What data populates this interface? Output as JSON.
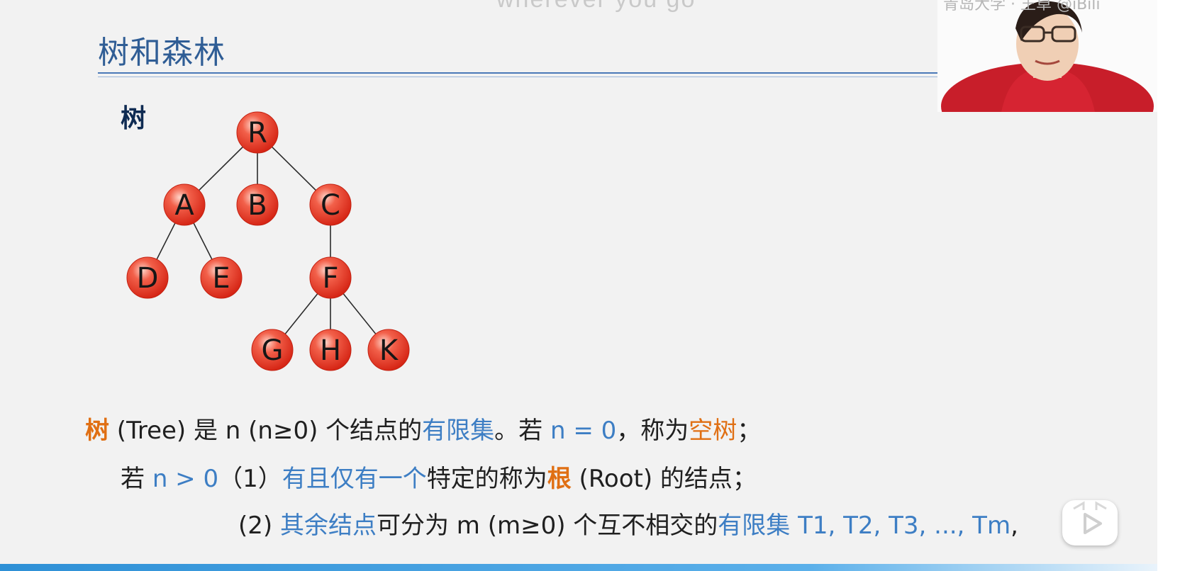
{
  "slide": {
    "top_ghost": "wherever you go",
    "title": "树和森林",
    "tree_label": "树",
    "tree_nodes": [
      {
        "id": "R",
        "label": "R"
      },
      {
        "id": "A",
        "label": "A"
      },
      {
        "id": "B",
        "label": "B"
      },
      {
        "id": "C",
        "label": "C"
      },
      {
        "id": "D",
        "label": "D"
      },
      {
        "id": "E",
        "label": "E"
      },
      {
        "id": "F",
        "label": "F"
      },
      {
        "id": "G",
        "label": "G"
      },
      {
        "id": "H",
        "label": "H"
      },
      {
        "id": "K",
        "label": "K"
      }
    ],
    "tree_edges": [
      [
        "R",
        "A"
      ],
      [
        "R",
        "B"
      ],
      [
        "R",
        "C"
      ],
      [
        "A",
        "D"
      ],
      [
        "A",
        "E"
      ],
      [
        "C",
        "F"
      ],
      [
        "F",
        "G"
      ],
      [
        "F",
        "H"
      ],
      [
        "F",
        "K"
      ]
    ],
    "definition": {
      "line1": {
        "term": "树",
        "part1": " (Tree) 是 n (n≥0) 个结点的",
        "finite_set": "有限集",
        "part2": "。若 ",
        "n_zero": "n = 0",
        "part3": "，称为",
        "empty_tree": "空树",
        "part4": "；"
      },
      "line2": {
        "prefix": "若 ",
        "n_gt": "n > 0",
        "item": "（1）",
        "unique": "有且仅有一个",
        "part1": "特定的称为",
        "root": "根",
        "part2": " (Root) 的结点；"
      },
      "line3": {
        "item": "(2) ",
        "rest_nodes": "其余结点",
        "part1": "可分为 m (m≥0) 个互不相交的",
        "finite_sets": "有限集 T1, T2, T3, ..., Tm",
        "part2": ","
      }
    }
  },
  "webcam": {
    "ghost_text": "青岛大学 · 王卓 @iBili"
  },
  "colors": {
    "title": "#2f5d95",
    "node_fill": "#e53a2a",
    "highlight_orange": "#e06f13",
    "highlight_blue": "#3d7ec4"
  }
}
